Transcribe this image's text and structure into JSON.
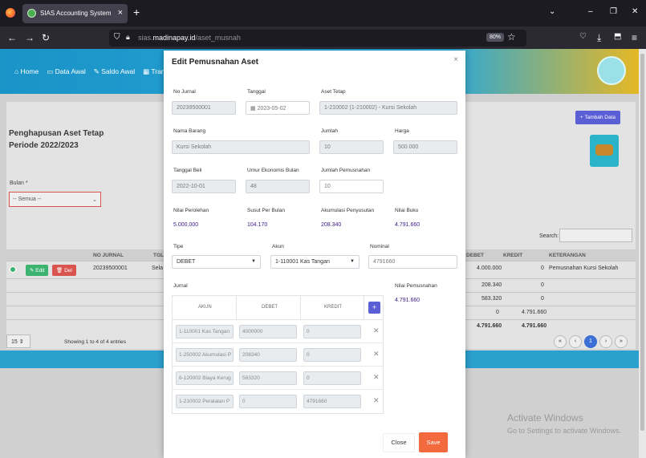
{
  "browser": {
    "tab_title": "SIAS Accounting System",
    "tab_close": "×",
    "new_tab": "+",
    "url_prefix": "sias.",
    "url_host": "madinapay.id",
    "url_path": "/aset_musnah",
    "zoom": "80%",
    "win_minimize": "–",
    "win_maximize": "❐",
    "win_close": "✕",
    "chevron": "⌄"
  },
  "app": {
    "nav": [
      "Home",
      "Data Awal",
      "Saldo Awal",
      "Trans"
    ],
    "page_title_line1": "Penghapusan Aset Tetap",
    "page_title_line2": "Periode 2022/2023",
    "bulan_label": "Bulan *",
    "bulan_value": "-- Semua --",
    "tambah_label": "+ Tambah Data",
    "search_label": "Search:",
    "table_headers": {
      "no_jurnal": "NO JURNAL",
      "tgl": "TGL",
      "debet": "DEBET",
      "kredit": "KREDIT",
      "keterangan": "KETERANGAN"
    },
    "row": {
      "no_jurnal": "20239500001",
      "akun_part": "Sela",
      "edit": "Edit",
      "del": "Del"
    },
    "debet_values": [
      "4.000.000",
      "208.340",
      "583.320",
      "0",
      "4.791.660"
    ],
    "kredit_values": [
      "0",
      "0",
      "0",
      "4.791.660",
      "4.791.660"
    ],
    "keterangan": "Pemusnahan Kursi Sekolah",
    "page_size": "15",
    "showing": "Showing 1 to 4 of 4 entries",
    "pages": [
      "«",
      "‹",
      "1",
      "›",
      "»"
    ],
    "watermark_title": "Activate Windows",
    "watermark_sub": "Go to Settings to activate Windows."
  },
  "modal": {
    "title": "Edit Pemusnahan Aset",
    "close_x": "×",
    "labels": {
      "no_jurnal": "No Jurnal",
      "tanggal": "Tanggal",
      "aset_tetap": "Aset Tetap",
      "nama_barang": "Nama Barang",
      "jumlah": "Jumlah",
      "harga": "Harga",
      "tanggal_beli": "Tanggal Beli",
      "umur": "Umur Ekonomis Bulan",
      "jumlah_pemusnahan": "Jumlah Pemusnahan",
      "nilai_perolehan": "Nilai Perolehan",
      "susut": "Susut Per Bulan",
      "akumulasi": "Akumulasi Penyusutan",
      "nilai_buku": "Nilai Buku",
      "tipe": "Tipe",
      "akun": "Akun",
      "nominal": "Nominal",
      "jurnal": "Jurnal",
      "nilai_pemusnahan": "Nilai Pemusnahan"
    },
    "values": {
      "no_jurnal": "20239500001",
      "tanggal": "2023-05-02",
      "aset_tetap": "1-210002 (1-210002) - Kursi Sekolah",
      "nama_barang": "Kursi Sekolah",
      "jumlah": "10",
      "harga": "500.000",
      "tanggal_beli": "2022-10-01",
      "umur": "48",
      "jumlah_pemusnahan": "10",
      "nilai_perolehan": "5.000.000",
      "susut": "104.170",
      "akumulasi": "208.340",
      "nilai_buku": "4.791.660",
      "tipe": "DEBET",
      "akun": "1-110001 Kas Tangan",
      "nominal": "4791660",
      "nilai_pemusnahan": "4.791.660"
    },
    "jurnal_headers": [
      "AKUN",
      "DEBET",
      "KREDIT"
    ],
    "jurnal_add": "+",
    "jurnal_rows": [
      {
        "akun": "1-110001 Kas Tangan",
        "debet": "4000000",
        "kredit": "0"
      },
      {
        "akun": "1-250002 Akumulasi P",
        "debet": "208340",
        "kredit": "0"
      },
      {
        "akun": "6-120002 Biaya Kerug",
        "debet": "583320",
        "kredit": "0"
      },
      {
        "akun": "1-210002 Peralatan P",
        "debet": "0",
        "kredit": "4791660"
      }
    ],
    "remove_icon": "✕",
    "close_label": "Close",
    "save_label": "Save"
  },
  "colors": {
    "accent": "#5a5fd6",
    "save": "#f26a3e",
    "header": "#2aa7d8"
  }
}
